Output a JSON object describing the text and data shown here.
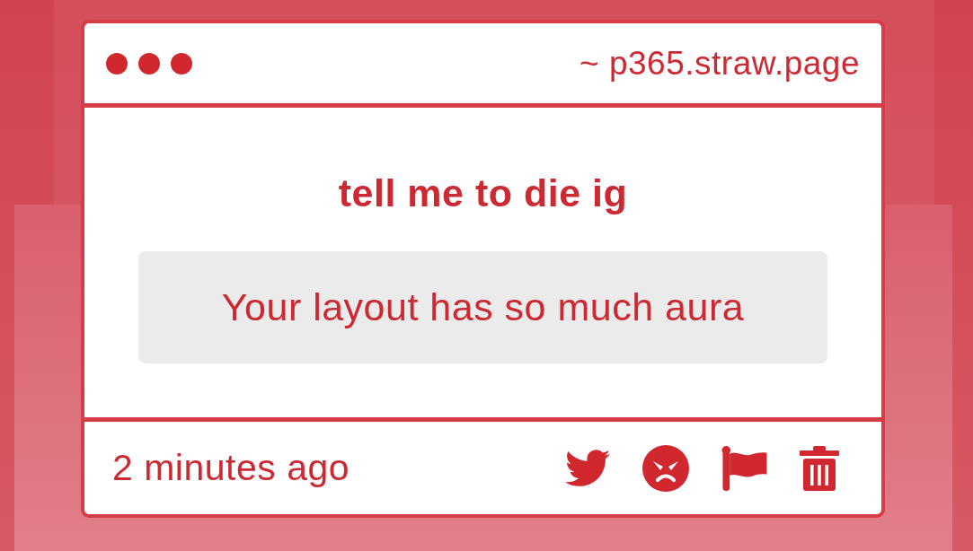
{
  "header": {
    "url": "~ p365.straw.page"
  },
  "prompt": {
    "title": "tell me to die ig"
  },
  "message": {
    "text": "Your layout has so much aura"
  },
  "footer": {
    "time": "2 minutes ago",
    "actions": [
      {
        "kind": "twitter"
      },
      {
        "kind": "angry"
      },
      {
        "kind": "flag"
      },
      {
        "kind": "trash"
      }
    ]
  }
}
